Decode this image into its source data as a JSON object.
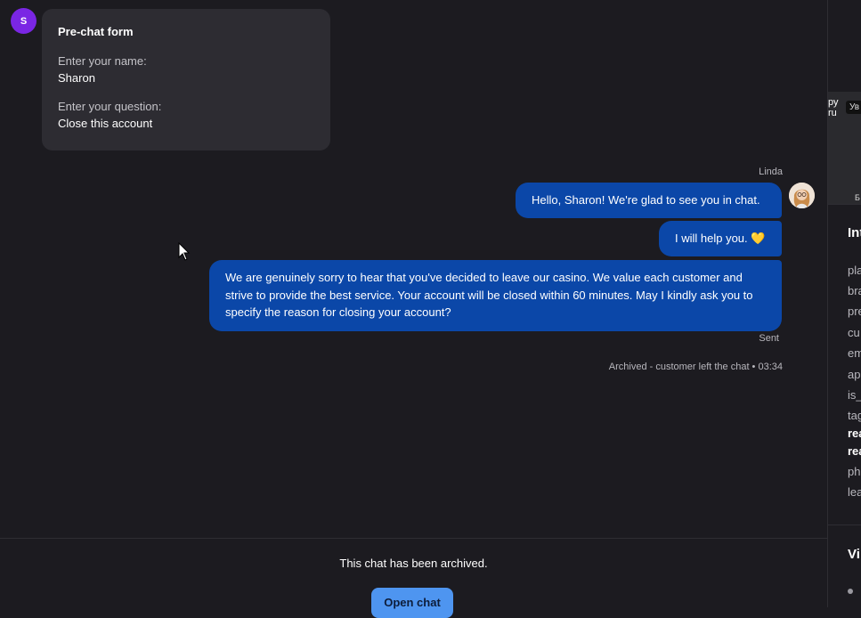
{
  "customer": {
    "avatar_initial": "S"
  },
  "prechat_form": {
    "title": "Pre-chat form",
    "fields": [
      {
        "label": "Enter your name:",
        "value": "Sharon"
      },
      {
        "label": "Enter your question:",
        "value": "Close this account"
      }
    ]
  },
  "agent": {
    "name": "Linda"
  },
  "messages": [
    {
      "text": "Hello, Sharon! We're glad to see you in chat."
    },
    {
      "text": "I will help you."
    },
    {
      "text": "We are genuinely sorry to hear that you've decided to leave our casino. We value each customer and strive to provide the best service. Your account will be closed within 60 minutes. May I kindly ask you to specify the reason for closing your account?"
    }
  ],
  "message_status": "Sent",
  "archive_notice": "Archived - customer left the chat • 03:34",
  "bottom": {
    "archived_text": "This chat has been archived.",
    "open_chat_label": "Open chat"
  },
  "side_panel": {
    "map_text_1": "ру",
    "map_text_2": "ru",
    "map_pill": "Ув",
    "map_text_3": "Б",
    "info_title": "Int",
    "fields": [
      "pla",
      "bra",
      "pre",
      "cu",
      "em",
      "ap",
      "is_",
      "tag",
      "rea",
      "rea",
      "ph",
      "lea"
    ],
    "visit_title": "Vi"
  },
  "colors": {
    "background": "#1c1b20",
    "agent_bubble": "#0b47a8",
    "prechat_card": "#2d2c32",
    "avatar_purple": "#7a26e4",
    "open_chat_button": "#4e95f0"
  }
}
